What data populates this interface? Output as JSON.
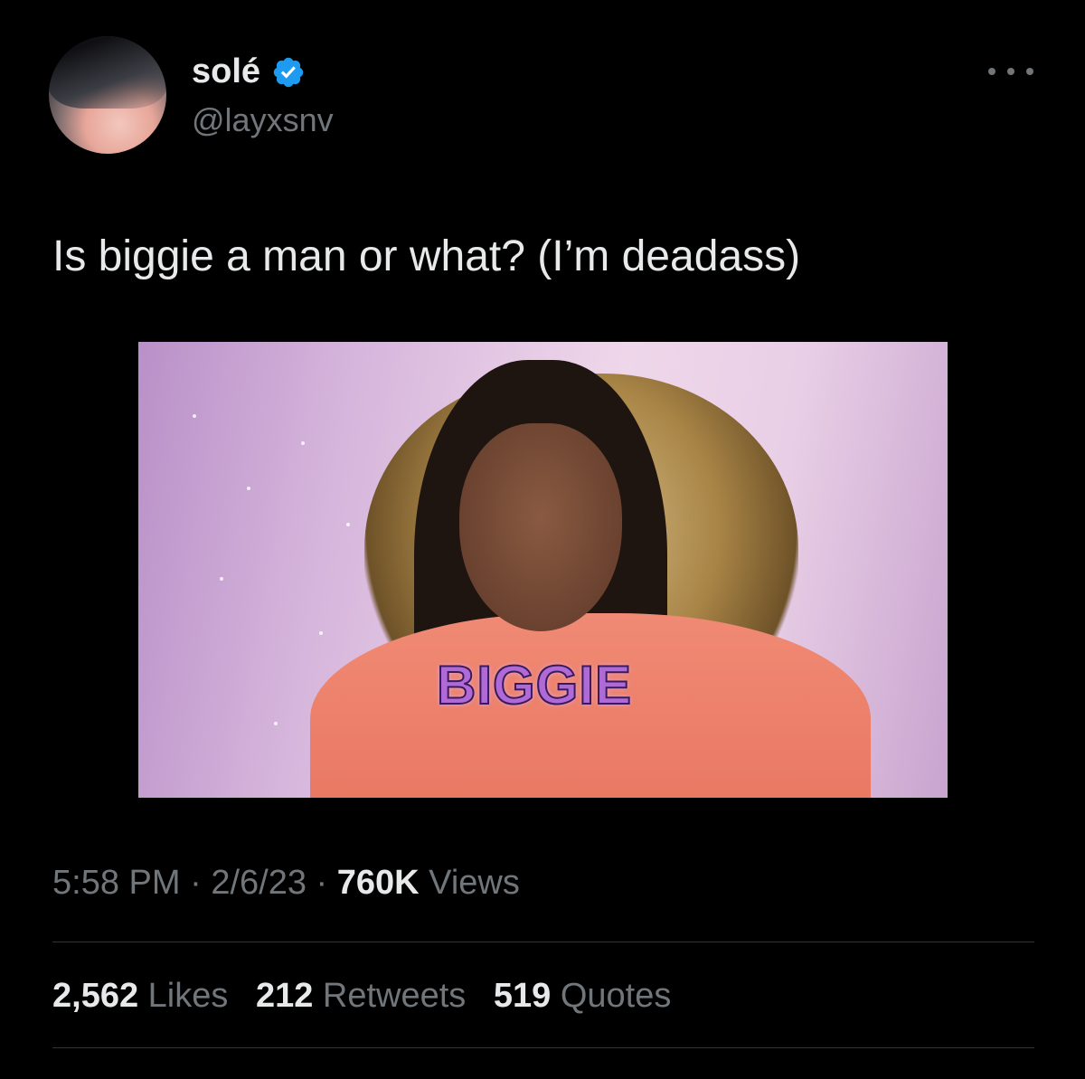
{
  "author": {
    "display_name": "solé",
    "handle": "@layxsnv",
    "verified": true
  },
  "tweet": {
    "text": "Is biggie a man or what? (I’m deadass)",
    "media_caption": "BIGGIE"
  },
  "meta": {
    "time": "5:58 PM",
    "separator": "·",
    "date": "2/6/23",
    "views_count": "760K",
    "views_label": "Views"
  },
  "stats": {
    "likes_count": "2,562",
    "likes_label": "Likes",
    "retweets_count": "212",
    "retweets_label": "Retweets",
    "quotes_count": "519",
    "quotes_label": "Quotes"
  },
  "colors": {
    "background": "#000000",
    "text": "#e7e9ea",
    "secondary_text": "#71767b",
    "verified_badge": "#1d9bf0"
  },
  "icons": [
    "verified-badge-icon",
    "more-options-icon"
  ]
}
